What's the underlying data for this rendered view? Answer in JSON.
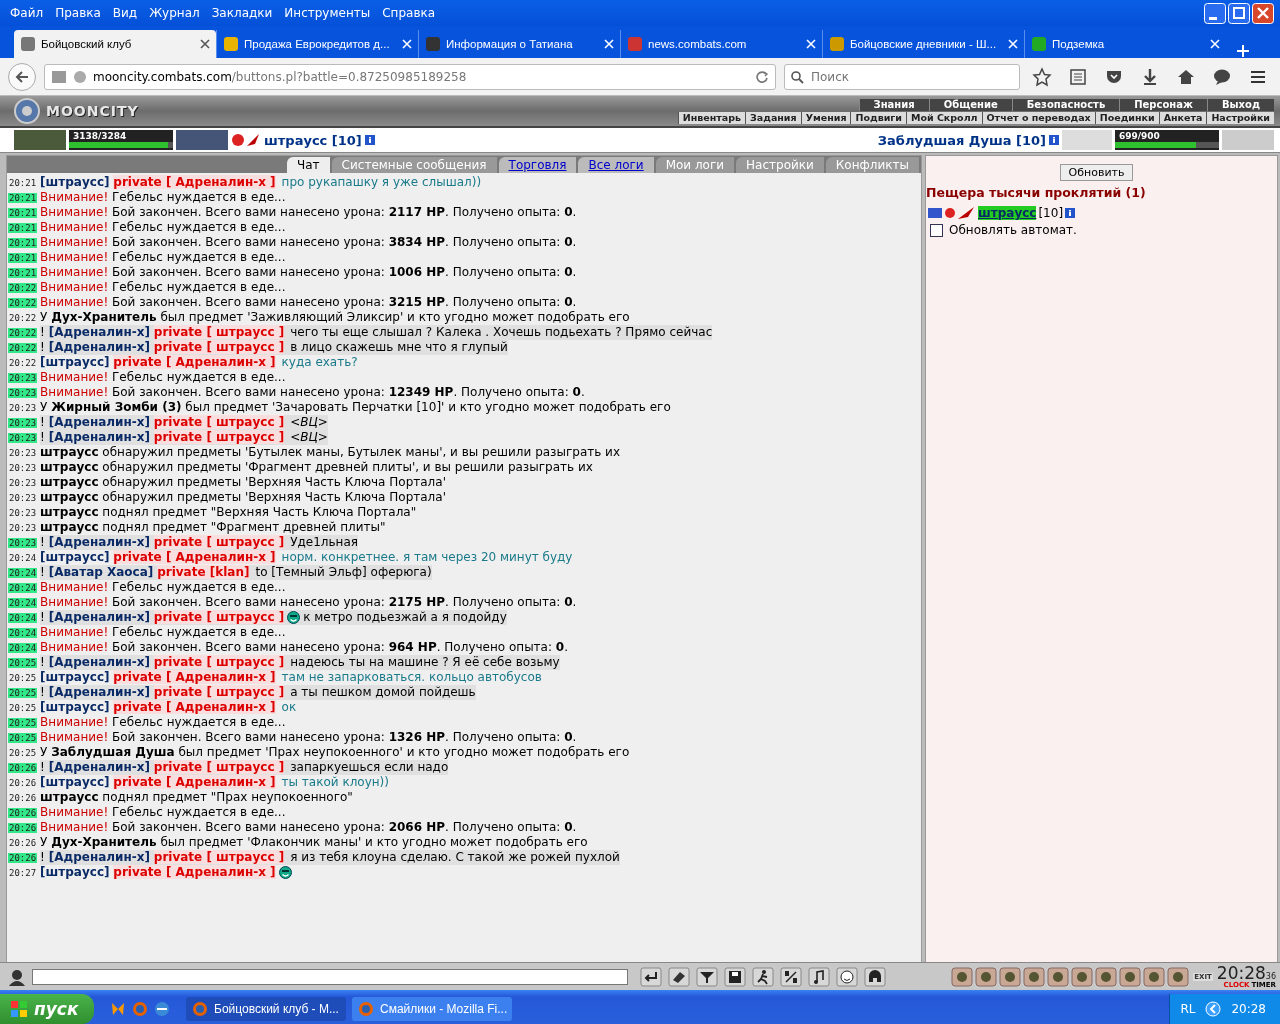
{
  "menu_bar": {
    "items": [
      "Файл",
      "Правка",
      "Вид",
      "Журнал",
      "Закладки",
      "Инструменты",
      "Справка"
    ]
  },
  "browser_tabs": [
    {
      "title": "Бойцовский клуб",
      "selected": true
    },
    {
      "title": "Продажа Еврокредитов д...",
      "selected": false
    },
    {
      "title": "Информация о Татиана",
      "selected": false
    },
    {
      "title": "news.combats.com",
      "selected": false
    },
    {
      "title": "Бойцовские дневники - Ш...",
      "selected": false
    },
    {
      "title": "Подземка",
      "selected": false
    }
  ],
  "address_bar": {
    "host": "mooncity.combats.com",
    "path": "/buttons.pl?battle=0.87250985189258"
  },
  "search": {
    "placeholder": "Поиск"
  },
  "game_header": {
    "logo": "MOONCITY",
    "main_menu": [
      "Знания",
      "Общение",
      "Безопасность",
      "Персонаж",
      "Выход"
    ],
    "sub_menu": [
      "Инвентарь",
      "Задания",
      "Умения",
      "Подвиги",
      "Мой Скролл",
      "Отчет о переводах",
      "Поединки",
      "Анкета",
      "Настройки"
    ]
  },
  "player": {
    "name": "штраусс [10]",
    "health": {
      "reading": "3138/3284",
      "level": 0.955
    }
  },
  "opponent": {
    "name": "Заблудшая Душа [10]",
    "health": {
      "reading": "699/900",
      "level": 0.777
    }
  },
  "chat": {
    "tabs": [
      {
        "label": "Чат",
        "selected": true,
        "link": false
      },
      {
        "label": "Системные сообщения",
        "selected": false,
        "link": false
      },
      {
        "label": "Торговля",
        "selected": false,
        "link": true
      },
      {
        "label": "Все логи",
        "selected": false,
        "link": true
      },
      {
        "label": "Мои логи",
        "selected": false,
        "link": false
      },
      {
        "label": "Настройки",
        "selected": false,
        "link": false
      },
      {
        "label": "Конфликты",
        "selected": false,
        "link": false
      }
    ],
    "messages": [
      {
        "time": "20:21",
        "highlighted": false,
        "kind": "private",
        "incoming": false,
        "sender": "[штраусс]",
        "tag": "private [ Адреналин-х ]",
        "text": "про рукапашку я уже слышал))"
      },
      {
        "time": "20:21",
        "highlighted": true,
        "kind": "alert",
        "label": "Внимание!",
        "text": "Гебельс нуждается в еде..."
      },
      {
        "time": "20:21",
        "highlighted": true,
        "kind": "alert",
        "label": "Внимание!",
        "text": "Бой закончен. Всего вами нанесено урона: **2117 HP**. Получено опыта: **0**."
      },
      {
        "time": "20:21",
        "highlighted": true,
        "kind": "alert",
        "label": "Внимание!",
        "text": "Гебельс нуждается в еде..."
      },
      {
        "time": "20:21",
        "highlighted": true,
        "kind": "alert",
        "label": "Внимание!",
        "text": "Бой закончен. Всего вами нанесено урона: **3834 HP**. Получено опыта: **0**."
      },
      {
        "time": "20:21",
        "highlighted": true,
        "kind": "alert",
        "label": "Внимание!",
        "text": "Гебельс нуждается в еде..."
      },
      {
        "time": "20:21",
        "highlighted": true,
        "kind": "alert",
        "label": "Внимание!",
        "text": "Бой закончен. Всего вами нанесено урона: **1006 HP**. Получено опыта: **0**."
      },
      {
        "time": "20:22",
        "highlighted": true,
        "kind": "alert",
        "label": "Внимание!",
        "text": "Гебельс нуждается в еде..."
      },
      {
        "time": "20:22",
        "highlighted": true,
        "kind": "alert",
        "label": "Внимание!",
        "text": "Бой закончен. Всего вами нанесено урона: **3215 HP**. Получено опыта: **0**."
      },
      {
        "time": "20:22",
        "highlighted": false,
        "kind": "event",
        "text": "У **Дух-Хранитель** был предмет 'Заживляющий Эликсир' и кто угодно может подобрать его"
      },
      {
        "time": "20:22",
        "highlighted": true,
        "kind": "private",
        "incoming": true,
        "prefix": "!",
        "sender": "[Адреналин-х]",
        "tag": "private [ штраусс ]",
        "text": "чего ты еще слышал ? Калека . Хочешь подьехать ? Прямо сейчас"
      },
      {
        "time": "20:22",
        "highlighted": true,
        "kind": "private",
        "incoming": true,
        "prefix": "!",
        "sender": "[Адреналин-х]",
        "tag": "private [ штраусс ]",
        "text": "в лицо скажешь мне что я глупый"
      },
      {
        "time": "20:22",
        "highlighted": false,
        "kind": "private",
        "incoming": false,
        "sender": "[штраусс]",
        "tag": "private [ Адреналин-х ]",
        "text": "куда ехать?"
      },
      {
        "time": "20:23",
        "highlighted": true,
        "kind": "alert",
        "label": "Внимание!",
        "text": "Гебельс нуждается в еде..."
      },
      {
        "time": "20:23",
        "highlighted": true,
        "kind": "alert",
        "label": "Внимание!",
        "text": "Бой закончен. Всего вами нанесено урона: **12349 HP**. Получено опыта: **0**."
      },
      {
        "time": "20:23",
        "highlighted": false,
        "kind": "event",
        "text": "У **Жирный Зомби (3)** был предмет 'Зачаровать Перчатки [10]' и кто угодно может подобрать его"
      },
      {
        "time": "20:23",
        "highlighted": true,
        "kind": "private",
        "incoming": true,
        "prefix": "!",
        "sender": "[Адреналин-х]",
        "tag": "private [ штраусс ]",
        "text": "*<ВЦ>*"
      },
      {
        "time": "20:23",
        "highlighted": true,
        "kind": "private",
        "incoming": true,
        "prefix": "!",
        "sender": "[Адреналин-х]",
        "tag": "private [ штраусс ]",
        "text": "*<ВЦ>*"
      },
      {
        "time": "20:23",
        "highlighted": false,
        "kind": "event",
        "text": "**штраусс** обнаружил предметы 'Бутылек маны, Бутылек маны', и вы решили разыграть их"
      },
      {
        "time": "20:23",
        "highlighted": false,
        "kind": "event",
        "text": "**штраусс** обнаружил предметы 'Фрагмент древней плиты', и вы решили разыграть их"
      },
      {
        "time": "20:23",
        "highlighted": false,
        "kind": "event",
        "text": "**штраусс** обнаружил предметы 'Верхняя Часть Ключа Портала'"
      },
      {
        "time": "20:23",
        "highlighted": false,
        "kind": "event",
        "text": "**штраусс** обнаружил предметы 'Верхняя Часть Ключа Портала'"
      },
      {
        "time": "20:23",
        "highlighted": false,
        "kind": "event",
        "text": "**штраусс** поднял предмет \"Верхняя Часть Ключа Портала\""
      },
      {
        "time": "20:23",
        "highlighted": false,
        "kind": "event",
        "text": "**штраусс** поднял предмет \"Фрагмент древней плиты\""
      },
      {
        "time": "20:23",
        "highlighted": true,
        "kind": "private",
        "incoming": true,
        "prefix": "!",
        "sender": "[Адреналин-х]",
        "tag": "private [ штраусс ]",
        "text": "Уде1льная"
      },
      {
        "time": "20:24",
        "highlighted": false,
        "kind": "private",
        "incoming": false,
        "sender": "[штраусс]",
        "tag": "private [ Адреналин-х ]",
        "text": "норм. конкретнее. я там через 20 минут буду"
      },
      {
        "time": "20:24",
        "highlighted": true,
        "kind": "private",
        "incoming": true,
        "prefix": "!",
        "sender": "[Аватар Хаоса]",
        "tag": "private [klan]",
        "text": "to [Темный Эльф] оферюга)"
      },
      {
        "time": "20:24",
        "highlighted": true,
        "kind": "alert",
        "label": "Внимание!",
        "text": "Гебельс нуждается в еде..."
      },
      {
        "time": "20:24",
        "highlighted": true,
        "kind": "alert",
        "label": "Внимание!",
        "text": "Бой закончен. Всего вами нанесено урона: **2175 HP**. Получено опыта: **0**."
      },
      {
        "time": "20:24",
        "highlighted": true,
        "kind": "private",
        "incoming": true,
        "prefix": "!",
        "sender": "[Адреналин-х]",
        "tag": "private [ штраусс ]",
        "smiley": true,
        "text": "к метро подьезжай а я подойду"
      },
      {
        "time": "20:24",
        "highlighted": true,
        "kind": "alert",
        "label": "Внимание!",
        "text": "Гебельс нуждается в еде..."
      },
      {
        "time": "20:24",
        "highlighted": true,
        "kind": "alert",
        "label": "Внимание!",
        "text": "Бой закончен. Всего вами нанесено урона: **964 HP**. Получено опыта: **0**."
      },
      {
        "time": "20:25",
        "highlighted": true,
        "kind": "private",
        "incoming": true,
        "prefix": "!",
        "sender": "[Адреналин-х]",
        "tag": "private [ штраусс ]",
        "text": "надеюсь ты на машине ? Я её себе возьму"
      },
      {
        "time": "20:25",
        "highlighted": false,
        "kind": "private",
        "incoming": false,
        "sender": "[штраусс]",
        "tag": "private [ Адреналин-х ]",
        "text": "там не запарковаться. кольцо автобусов"
      },
      {
        "time": "20:25",
        "highlighted": true,
        "kind": "private",
        "incoming": true,
        "prefix": "!",
        "sender": "[Адреналин-х]",
        "tag": "private [ штраусс ]",
        "text": "а ты пешком домой пойдешь"
      },
      {
        "time": "20:25",
        "highlighted": false,
        "kind": "private",
        "incoming": false,
        "sender": "[штраусс]",
        "tag": "private [ Адреналин-х ]",
        "text": "ок"
      },
      {
        "time": "20:25",
        "highlighted": true,
        "kind": "alert",
        "label": "Внимание!",
        "text": "Гебельс нуждается в еде..."
      },
      {
        "time": "20:25",
        "highlighted": true,
        "kind": "alert",
        "label": "Внимание!",
        "text": "Бой закончен. Всего вами нанесено урона: **1326 HP**. Получено опыта: **0**."
      },
      {
        "time": "20:25",
        "highlighted": false,
        "kind": "event",
        "text": "У **Заблудшая Душа** был предмет 'Прах неупокоенного' и кто угодно может подобрать его"
      },
      {
        "time": "20:26",
        "highlighted": true,
        "kind": "private",
        "incoming": true,
        "prefix": "!",
        "sender": "[Адреналин-х]",
        "tag": "private [ штраусс ]",
        "text": "запаркуешься если надо"
      },
      {
        "time": "20:26",
        "highlighted": false,
        "kind": "private",
        "incoming": false,
        "sender": "[штраусс]",
        "tag": "private [ Адреналин-х ]",
        "text": "ты такой клоун))"
      },
      {
        "time": "20:26",
        "highlighted": false,
        "kind": "event",
        "text": "**штраусс** поднял предмет \"Прах неупокоенного\""
      },
      {
        "time": "20:26",
        "highlighted": true,
        "kind": "alert",
        "label": "Внимание!",
        "text": "Гебельс нуждается в еде..."
      },
      {
        "time": "20:26",
        "highlighted": true,
        "kind": "alert",
        "label": "Внимание!",
        "text": "Бой закончен. Всего вами нанесено урона: **2066 HP**. Получено опыта: **0**."
      },
      {
        "time": "20:26",
        "highlighted": false,
        "kind": "event",
        "text": "У **Дух-Хранитель** был предмет 'Флакончик маны' и кто угодно может подобрать его"
      },
      {
        "time": "20:26",
        "highlighted": true,
        "kind": "private",
        "incoming": true,
        "prefix": "!",
        "sender": "[Адреналин-х]",
        "tag": "private [ штраусс ]",
        "text": "я из тебя клоуна сделаю. С такой же рожей пухлой"
      },
      {
        "time": "20:27",
        "highlighted": false,
        "kind": "private",
        "incoming": false,
        "sender": "[штраусс]",
        "tag": "private [ Адреналин-х ]",
        "smiley": true
      }
    ]
  },
  "side_panel": {
    "refresh_button": "Обновить",
    "location": "Пещера тысячи проклятий (1)",
    "users": [
      {
        "name": "штраусс",
        "rank": "[10]"
      }
    ],
    "auto_refresh": {
      "label": "Обновлять автомат.",
      "checked": false
    }
  },
  "bottom_bar": {
    "exit_label": "EXIT",
    "clock": "20:28",
    "seconds": "36",
    "clock_label": "CLOCK",
    "timer_label": "TIMER"
  },
  "taskbar": {
    "start": "пуск",
    "tasks": [
      {
        "title": "Бойцовский клуб - M...",
        "selected": true
      },
      {
        "title": "Смайлики - Mozilla Fi...",
        "selected": false
      }
    ],
    "language": "RL",
    "time": "20:28"
  }
}
